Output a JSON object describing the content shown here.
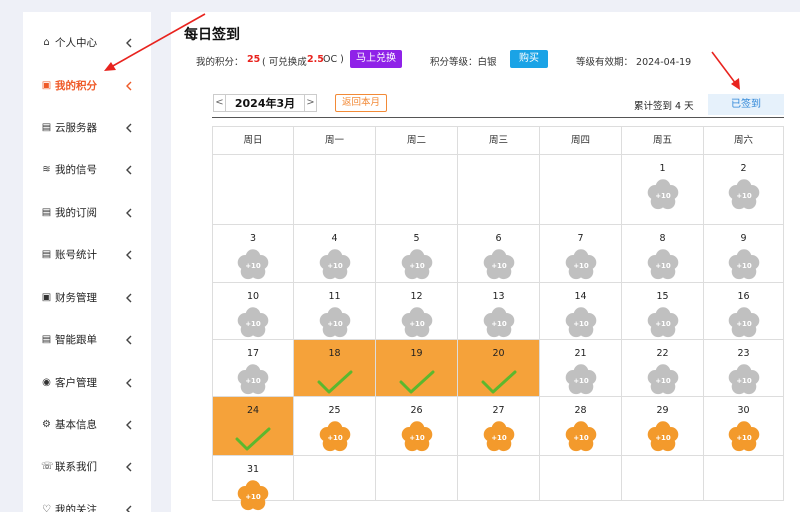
{
  "sidebar": {
    "items": [
      {
        "label": "个人中心",
        "icon": "home-icon",
        "glyph": "⌂"
      },
      {
        "label": "我的积分",
        "icon": "points-icon",
        "glyph": "▣",
        "active": true
      },
      {
        "label": "云服务器",
        "icon": "server-icon",
        "glyph": "▤"
      },
      {
        "label": "我的信号",
        "icon": "wifi-icon",
        "glyph": "≋"
      },
      {
        "label": "我的订阅",
        "icon": "subscription-icon",
        "glyph": "▤"
      },
      {
        "label": "账号统计",
        "icon": "stats-icon",
        "glyph": "▤"
      },
      {
        "label": "财务管理",
        "icon": "finance-icon",
        "glyph": "▣"
      },
      {
        "label": "智能跟单",
        "icon": "copy-trade-icon",
        "glyph": "▤"
      },
      {
        "label": "客户管理",
        "icon": "customer-icon",
        "glyph": "◉"
      },
      {
        "label": "基本信息",
        "icon": "settings-icon",
        "glyph": "⚙"
      },
      {
        "label": "联系我们",
        "icon": "contact-icon",
        "glyph": "☏"
      },
      {
        "label": "我的关注",
        "icon": "heart-icon",
        "glyph": "♡"
      }
    ]
  },
  "page": {
    "title": "每日签到",
    "points_label": "我的积分：",
    "points_value": "25",
    "exchange_prefix": "( 可兑换成",
    "exchange_value": "2.5",
    "exchange_suffix": "OC )",
    "exchange_button": "马上兑换",
    "level_label": "积分等级：白银",
    "buy_button": "购买",
    "validity": "等级有效期： 2024-04-19"
  },
  "calendar": {
    "prev": "<",
    "next": ">",
    "month": "2024年3月",
    "return_button": "返回本月",
    "total_signed": "累计签到 4 天",
    "signed_button": "已签到",
    "weekdays": [
      "周日",
      "周一",
      "周二",
      "周三",
      "周四",
      "周五",
      "周六"
    ],
    "reward_label": "+10",
    "first_weekday": 5,
    "days_in_month": 31,
    "signed_days": [
      18,
      19,
      20,
      24
    ],
    "future_from": 25,
    "colors": {
      "signed_bg": "#f5a23a",
      "past_flower": "#c0c0c0",
      "future_flower": "#f39a2c",
      "check": "#5cb82e"
    }
  },
  "colors": {
    "accent": "#ef5a28",
    "exchange_btn": "#8f22e8",
    "buy_btn": "#1aa3e6",
    "annotation_arrow": "#e8231e"
  }
}
